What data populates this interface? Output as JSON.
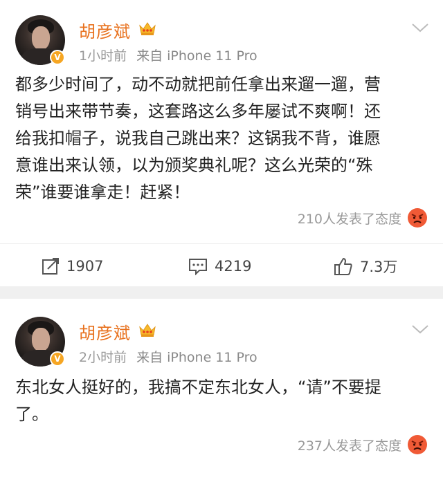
{
  "posts": [
    {
      "author": "胡彦斌",
      "time": "1小时前",
      "source": "来自 iPhone 11 Pro",
      "verified_mark": "V",
      "lines": [
        "都多少时间了，动不动就把前任拿出来遛一遛，营",
        "销号出来带节奏，这套路这么多年屡试不爽啊！还",
        "给我扣帽子，说我自己跳出来？这锅我不背，谁愿",
        "意谁出来认领，以为颁奖典礼呢？这么光荣的“殊",
        "荣”谁要谁拿走！赶紧！"
      ],
      "attitude": "210人发表了态度",
      "repost_count": "1907",
      "comment_count": "4219",
      "like_count": "7.3万"
    },
    {
      "author": "胡彦斌",
      "time": "2小时前",
      "source": "来自 iPhone 11 Pro",
      "verified_mark": "V",
      "lines": [
        "东北女人挺好的，我搞不定东北女人，“请”不要提",
        "了。"
      ],
      "attitude": "237人发表了态度"
    }
  ],
  "colors": {
    "author": "#e8721f",
    "meta": "#999999",
    "badge": "#f6a623",
    "angry_emoji": "#f04e2a",
    "separator": "#f0f0f0"
  },
  "icons": [
    "crown-icon",
    "chevron-down-icon",
    "verified-badge-icon",
    "angry-emoji-icon",
    "repost-icon",
    "comment-icon",
    "like-icon"
  ]
}
